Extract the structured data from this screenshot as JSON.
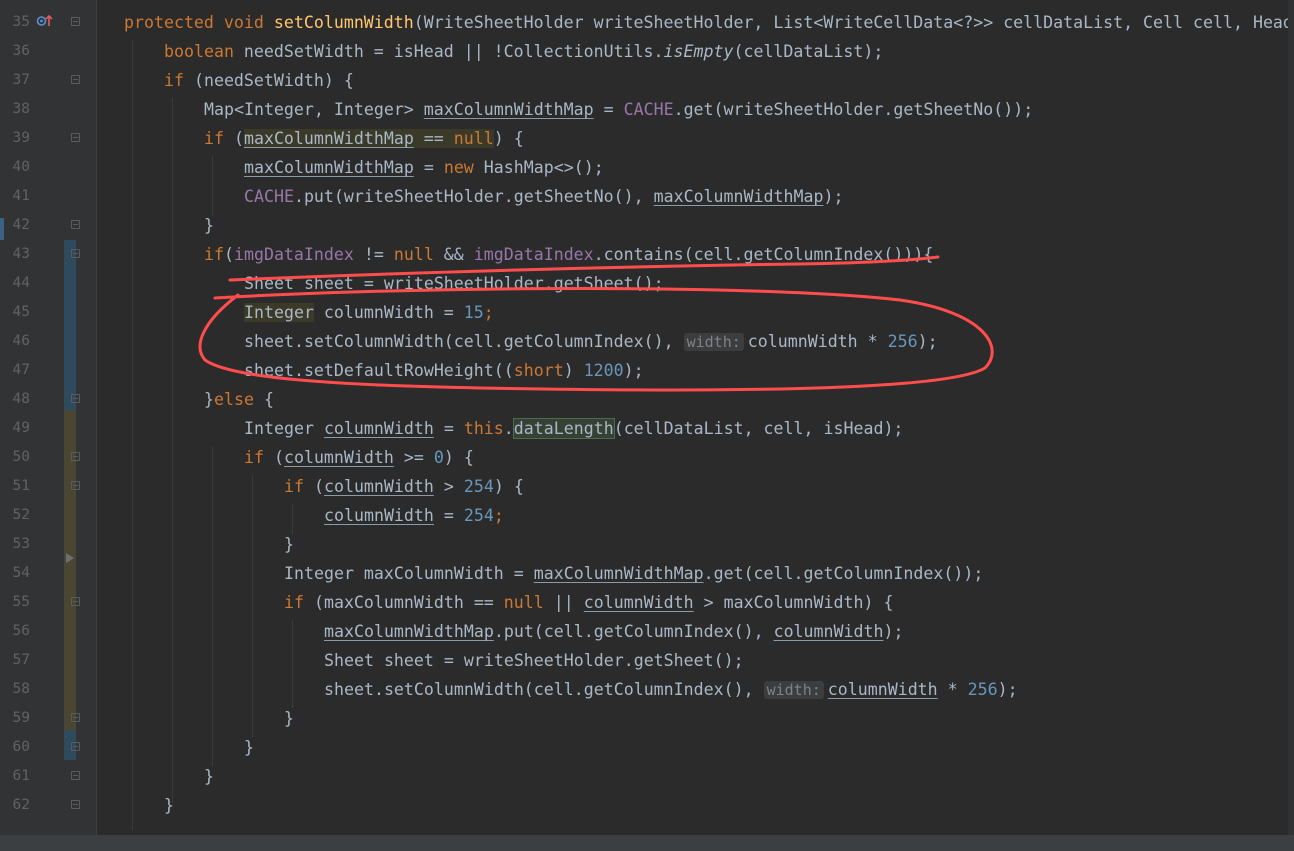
{
  "editor": {
    "line_numbers": [
      "35",
      "36",
      "37",
      "38",
      "39",
      "40",
      "41",
      "42",
      "43",
      "44",
      "45",
      "46",
      "47",
      "48",
      "49",
      "50",
      "51",
      "52",
      "53",
      "54",
      "55",
      "56",
      "57",
      "58",
      "59",
      "60",
      "61",
      "62"
    ],
    "override_marker_icon": "override-up-arrow-icon",
    "code": {
      "l35": {
        "a": "protected",
        "b": "void",
        "c": "setColumnWidth",
        "d": "(WriteSheetHolder writeSheetHolder, List<WriteCellData<?>> cellDataList, Cell cell, Head"
      },
      "l36": {
        "a": "boolean",
        "b": " needSetWidth = isHead || !CollectionUtils.",
        "c": "isEmpty",
        "d": "(cellDataList);"
      },
      "l37": {
        "a": "if",
        "b": " (needSetWidth) {"
      },
      "l38": {
        "a": "Map<Integer, Integer> ",
        "b": "maxColumnWidthMap",
        "c": " = ",
        "d": "CACHE",
        "e": ".get(writeSheetHolder.getSheetNo());"
      },
      "l39": {
        "a": "if",
        "b": " (",
        "c": "maxColumnWidthMap",
        "d": " == ",
        "e": "null",
        "f": ") {"
      },
      "l40": {
        "a": "maxColumnWidthMap",
        "b": " = ",
        "c": "new",
        "d": " HashMap<>();"
      },
      "l41": {
        "a": "CACHE",
        "b": ".put(writeSheetHolder.getSheetNo(), ",
        "c": "maxColumnWidthMap",
        "d": ");"
      },
      "l42": {
        "a": "}"
      },
      "l43": {
        "a": "if",
        "b": "(",
        "c": "imgDataIndex",
        "d": " != ",
        "e": "null",
        "f": " && ",
        "g": "imgDataIndex",
        ".h": "",
        "h": ".contains(cell.getColumnIndex())){"
      },
      "l44": {
        "a": "Sheet sheet = writeSheetHolder.getSheet();"
      },
      "l45": {
        "a": "Integer",
        "b": " columnWidth = ",
        "c": "15",
        "d": ";"
      },
      "l46": {
        "a": "sheet.setColumnWidth(cell.getColumnIndex(), ",
        "hint": "width:",
        "b": "columnWidth * ",
        "c": "256",
        "d": ");"
      },
      "l47": {
        "a": "sheet.setDefaultRowHeight((",
        "b": "short",
        "c": ") ",
        "d": "1200",
        "e": ");"
      },
      "l48": {
        "a": "}",
        "b": "else",
        "c": " {"
      },
      "l49": {
        "a": "Integer ",
        "b": "columnWidth",
        "c": " = ",
        "d": "this",
        "e": ".",
        "f": "dataLength",
        "g": "(cellDataList, cell, isHead);"
      },
      "l50": {
        "a": "if",
        "b": " (",
        "c": "columnWidth",
        "d": " >= ",
        "e": "0",
        "f": ") {"
      },
      "l51": {
        "a": "if",
        "b": " (",
        "c": "columnWidth",
        "d": " > ",
        "e": "254",
        "f": ") {"
      },
      "l52": {
        "a": "columnWidth",
        "b": " = ",
        "c": "254",
        "d": ";"
      },
      "l53": {
        "a": "}"
      },
      "l54": {
        "a": "Integer maxColumnWidth = ",
        "b": "maxColumnWidthMap",
        "c": ".get(cell.getColumnIndex());"
      },
      "l55": {
        "a": "if",
        "b": " (maxColumnWidth == ",
        "c": "null",
        "d": " || ",
        "e": "columnWidth",
        "f": " > maxColumnWidth) {"
      },
      "l56": {
        "a": "maxColumnWidthMap",
        "b": ".put(cell.getColumnIndex(), ",
        "c": "columnWidth",
        "d": ");"
      },
      "l57": {
        "a": "Sheet sheet = writeSheetHolder.getSheet();"
      },
      "l58": {
        "a": "sheet.setColumnWidth(cell.getColumnIndex(), ",
        "hint": "width:",
        "b": "columnWidth",
        "c": " * ",
        "d": "256",
        "e": ");"
      },
      "l59": {
        "a": "}"
      },
      "l60": {
        "a": "}"
      },
      "l61": {
        "a": "}"
      },
      "l62": {
        "a": "}"
      }
    },
    "colors": {
      "background": "#2b2b2b",
      "keyword": "#cc7832",
      "method": "#ffc66d",
      "number": "#6897bb",
      "field": "#9876aa",
      "text": "#a9b7c6",
      "annotation": "#ff4d4d"
    }
  }
}
